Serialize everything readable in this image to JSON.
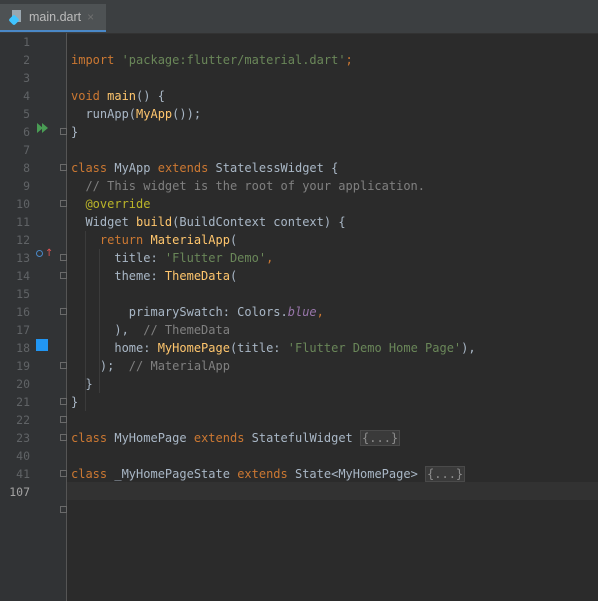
{
  "tab": {
    "filename": "main.dart",
    "close": "×"
  },
  "line_numbers": [
    "1",
    "2",
    "3",
    "4",
    "5",
    "6",
    "7",
    "8",
    "9",
    "10",
    "11",
    "12",
    "13",
    "14",
    "15",
    "16",
    "17",
    "18",
    "19",
    "20",
    "21",
    "22",
    "23",
    "40",
    "41",
    "107"
  ],
  "code": {
    "l2": {
      "a": "import ",
      "b": "'package:flutter/material.dart'",
      "c": ";"
    },
    "l4": {
      "a": "void ",
      "b": "main",
      "c": "() {"
    },
    "l5": {
      "a": "  runApp(",
      "b": "MyApp",
      "c": "());"
    },
    "l6": "}",
    "l8": {
      "a": "class ",
      "b": "MyApp ",
      "c": "extends ",
      "d": "StatelessWidget {"
    },
    "l9": "  // This widget is the root of your application.",
    "l10": {
      "a": "  ",
      "b": "@override"
    },
    "l11": {
      "a": "  Widget ",
      "b": "build",
      "c": "(BuildContext context) {"
    },
    "l12": {
      "a": "    ",
      "b": "return ",
      "c": "MaterialApp",
      "d": "("
    },
    "l13": {
      "a": "      title: ",
      "b": "'Flutter Demo'",
      "c": ","
    },
    "l14": {
      "a": "      theme: ",
      "b": "ThemeData",
      "c": "("
    },
    "l16": {
      "a": "        primarySwatch: Colors.",
      "b": "blue",
      "c": ","
    },
    "l17": {
      "a": "      ),  ",
      "b": "// ThemeData"
    },
    "l18": {
      "a": "      home: ",
      "b": "MyHomePage",
      "c": "(title: ",
      "d": "'Flutter Demo Home Page'",
      "e": "),"
    },
    "l19": {
      "a": "    );  ",
      "b": "// MaterialApp"
    },
    "l20": "  }",
    "l21": "}",
    "l23": {
      "a": "class ",
      "b": "MyHomePage ",
      "c": "extends ",
      "d": "StatefulWidget ",
      "e": "{...}"
    },
    "l41": {
      "a": "class ",
      "b": "_MyHomePageState ",
      "c": "extends ",
      "d": "State<MyHomePage> ",
      "e": "{...}"
    }
  },
  "colors": {
    "editor_bg": "#2b2b2b",
    "gutter_bg": "#313335",
    "keyword": "#cc7832",
    "string": "#6a8759",
    "function": "#ffc66d",
    "comment": "#808080",
    "annotation": "#bbb529",
    "field": "#9876aa",
    "swatch_blue": "#2196f3"
  },
  "gutter_icons": [
    "run-icon",
    "override-icon",
    "color-swatch-icon"
  ]
}
